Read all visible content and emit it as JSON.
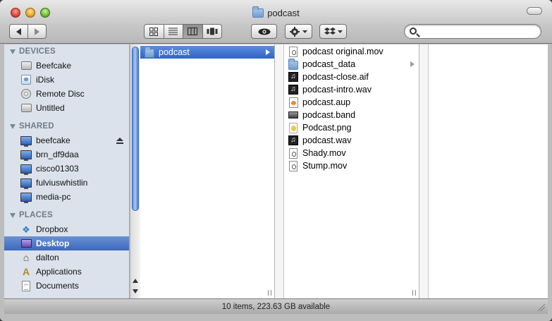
{
  "window": {
    "title": "podcast"
  },
  "toolbar": {
    "search_placeholder": ""
  },
  "sidebar": {
    "sections": [
      {
        "header": "DEVICES",
        "items": [
          {
            "label": "Beefcake",
            "icon": "hard-drive-icon"
          },
          {
            "label": "iDisk",
            "icon": "idisk-icon"
          },
          {
            "label": "Remote Disc",
            "icon": "disc-icon"
          },
          {
            "label": "Untitled",
            "icon": "hard-drive-icon"
          }
        ]
      },
      {
        "header": "SHARED",
        "items": [
          {
            "label": "beefcake",
            "icon": "network-computer-icon",
            "eject": true
          },
          {
            "label": "brn_df9daa",
            "icon": "network-computer-icon"
          },
          {
            "label": "cisco01303",
            "icon": "network-computer-icon"
          },
          {
            "label": "fulviuswhistlin",
            "icon": "network-computer-icon"
          },
          {
            "label": "media-pc",
            "icon": "network-computer-icon"
          }
        ]
      },
      {
        "header": "PLACES",
        "items": [
          {
            "label": "Dropbox",
            "icon": "dropbox-icon"
          },
          {
            "label": "Desktop",
            "icon": "desktop-icon",
            "selected": true
          },
          {
            "label": "dalton",
            "icon": "home-icon"
          },
          {
            "label": "Applications",
            "icon": "applications-icon"
          },
          {
            "label": "Documents",
            "icon": "documents-icon"
          }
        ]
      }
    ]
  },
  "columns": [
    {
      "items": [
        {
          "label": "podcast",
          "type": "folder",
          "selected": true,
          "has_children": true
        }
      ]
    },
    {
      "items": [
        {
          "label": "podcast original.mov",
          "type": "mov"
        },
        {
          "label": "podcast_data",
          "type": "folder",
          "has_children": true
        },
        {
          "label": "podcast-close.aif",
          "type": "audio"
        },
        {
          "label": "podcast-intro.wav",
          "type": "audio"
        },
        {
          "label": "podcast.aup",
          "type": "aup"
        },
        {
          "label": "podcast.band",
          "type": "band"
        },
        {
          "label": "Podcast.png",
          "type": "png"
        },
        {
          "label": "podcast.wav",
          "type": "audio"
        },
        {
          "label": "Shady.mov",
          "type": "mov"
        },
        {
          "label": "Stump.mov",
          "type": "mov"
        }
      ]
    },
    {
      "items": []
    }
  ],
  "status": {
    "text": "10 items, 223.63 GB available"
  }
}
